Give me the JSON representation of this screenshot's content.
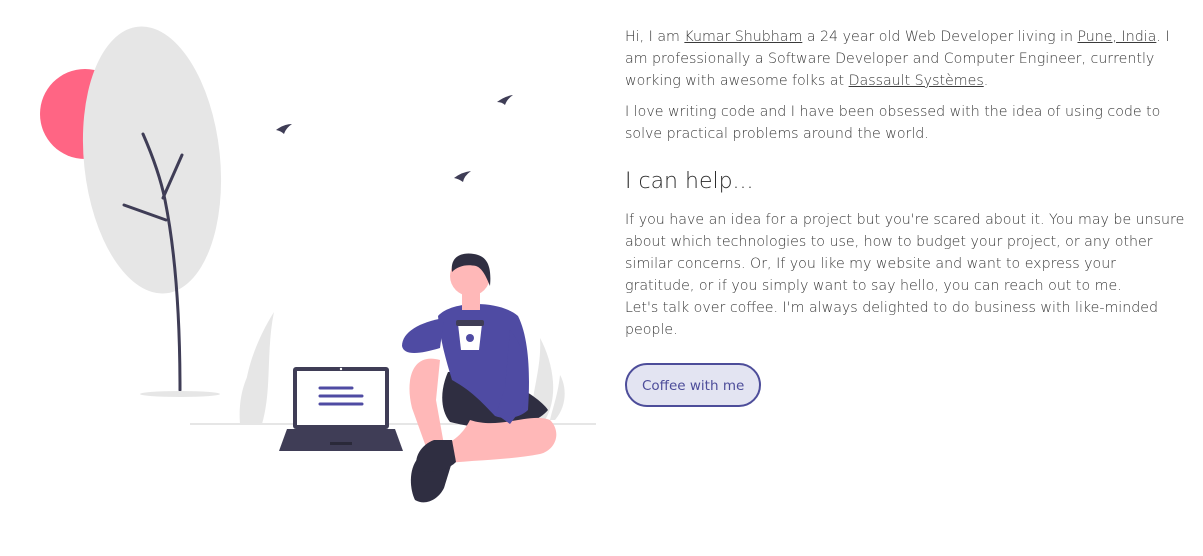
{
  "about": {
    "intro_prefix": "Hi, I am",
    "name_link": "Kumar Shubham",
    "intro_middle": "a 24 year old Web Developer living in",
    "location_link": "Pune, India",
    "intro_after_location": ". I am professionally a Software Developer and Computer Engineer, currently working with awesome folks at",
    "company_link": "Dassault Systèmes",
    "intro_end": ".",
    "love_text": "I love writing code and I have been obsessed with the idea of using code to solve practical problems around the world."
  },
  "help": {
    "heading": "I can help...",
    "body": "If you have an idea for a project but you're scared about it. You may be unsure about which technologies to use, how to budget your project, or any other similar concerns. Or, If you like my website and want to express your gratitude, or if you simply want to say hello, you can reach out to me.",
    "closing": "Let's talk over coffee. I'm always delighted to do business with like-minded people.",
    "button_label": "Coffee with me"
  },
  "colors": {
    "sun": "#ff6584",
    "shirt": "#4f4ba3",
    "accent": "#4d4d9a",
    "button_bg": "#e3e4f2"
  }
}
